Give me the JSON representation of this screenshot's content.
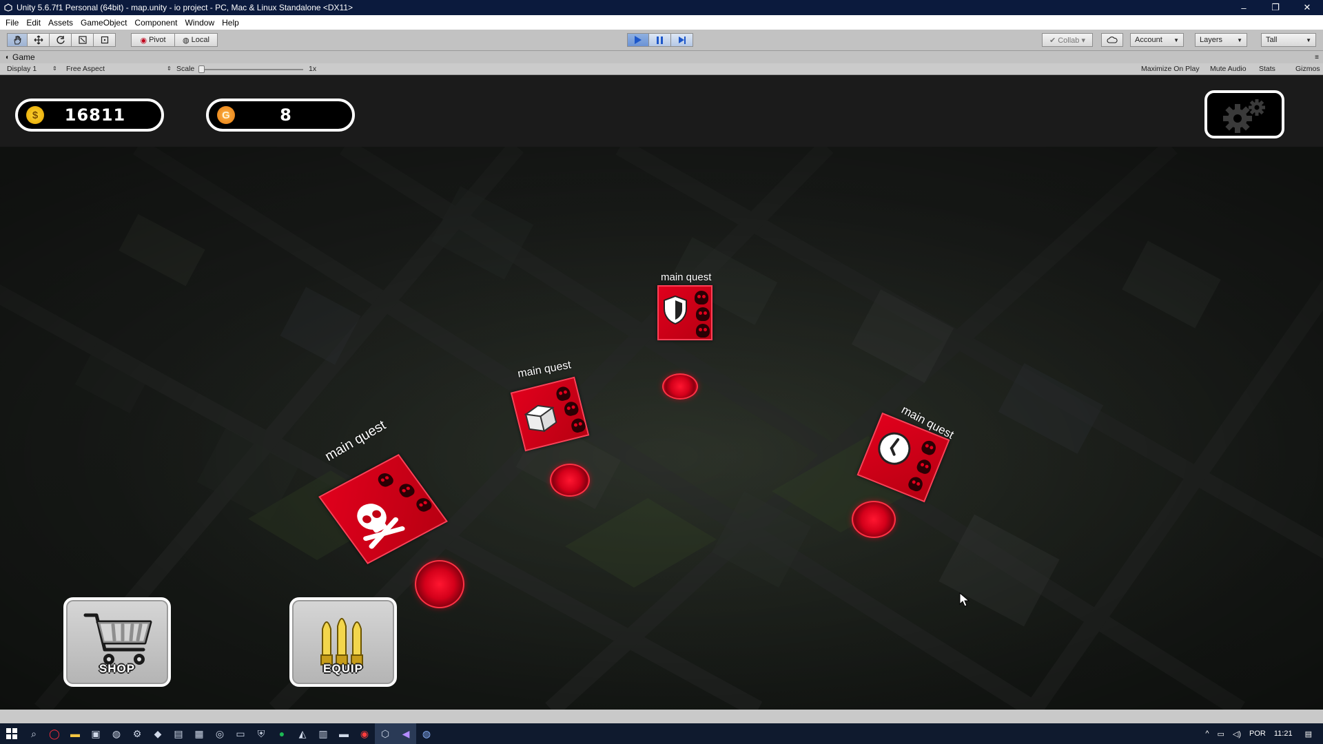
{
  "window": {
    "title": "Unity 5.6.7f1 Personal (64bit) - map.unity - io project - PC, Mac & Linux Standalone <DX11>",
    "minimize": "–",
    "restore": "❐",
    "close": "✕"
  },
  "menu": [
    "File",
    "Edit",
    "Assets",
    "GameObject",
    "Component",
    "Window",
    "Help"
  ],
  "toolbar": {
    "tools": [
      "hand-icon",
      "move-icon",
      "rotate-icon",
      "scale-icon",
      "rect-icon"
    ],
    "pivot": "Pivot",
    "local": "Local",
    "collab": "Collab ▾",
    "account": "Account",
    "layers": "Layers",
    "layout": "Tall"
  },
  "game_panel": {
    "tab": "Game",
    "display": "Display 1",
    "aspect": "Free Aspect",
    "scale_label": "Scale",
    "scale_value": "1x",
    "maximize": "Maximize On Play",
    "mute": "Mute Audio",
    "stats": "Stats",
    "gizmos": "Gizmos"
  },
  "hud": {
    "cash": "16811",
    "cash_icon": "$",
    "gems": "8",
    "gems_icon": "G"
  },
  "quests": [
    {
      "label": "main quest",
      "icon": "skull-crossbones-icon"
    },
    {
      "label": "main quest",
      "icon": "box-icon"
    },
    {
      "label": "main quest",
      "icon": "shield-icon"
    },
    {
      "label": "main quest",
      "icon": "clock-icon"
    }
  ],
  "buttons": {
    "shop": "SHOP",
    "equip": "EQUIP"
  },
  "tray": {
    "lang": "POR",
    "time": "11:21"
  },
  "colors": {
    "quest_red": "#e0001c",
    "play_blue": "#1c56c9",
    "gold": "#ffd634"
  }
}
